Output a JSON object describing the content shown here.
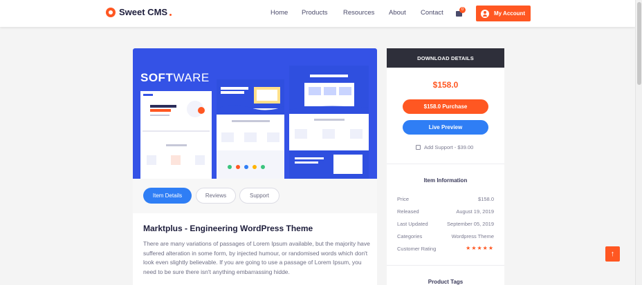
{
  "brand": {
    "name": "Sweet CMS"
  },
  "nav": {
    "items": [
      "Home",
      "Products",
      "Resources",
      "About",
      "Contact"
    ],
    "cart_count": "0",
    "account_label": "My Account"
  },
  "hero": {
    "title_bold": "SOFT",
    "title_rest": "WARE"
  },
  "tabs": [
    "Item Details",
    "Reviews",
    "Support"
  ],
  "product": {
    "title": "Marktplus - Engineering WordPress Theme",
    "description": "There are many variations of passages of Lorem Ipsum available, but the majority have suffered alteration in some form, by injected humour, or randomised words which don't look even slightly believable. If you are going to use a passage of Lorem Ipsum, you need to be sure there isn't anything embarrassing hidde."
  },
  "sidebar": {
    "header": "DOWNLOAD DETAILS",
    "price": "$158.0",
    "purchase_label": "$158.0 Purchase",
    "preview_label": "Live Preview",
    "support_label": "Add Support - $39.00",
    "info_title": "Item Information",
    "info": [
      {
        "label": "Price",
        "value": "$158.0"
      },
      {
        "label": "Released",
        "value": "August 19, 2019"
      },
      {
        "label": "Last Updated",
        "value": "September 05, 2019"
      },
      {
        "label": "Categories",
        "value": "Wordpress Theme"
      },
      {
        "label": "Customer Rating",
        "value": "★★★★★"
      }
    ],
    "tags_title": "Product Tags"
  },
  "colors": {
    "accent": "#ff5722",
    "primary": "#2f7ef5",
    "hero_bg": "#3452e6",
    "dark": "#2e2f3a"
  },
  "icons": {
    "logo": "logo-ring-icon",
    "cart": "shopping-bag-icon",
    "user": "user-icon",
    "back_to_top": "arrow-up-icon"
  }
}
